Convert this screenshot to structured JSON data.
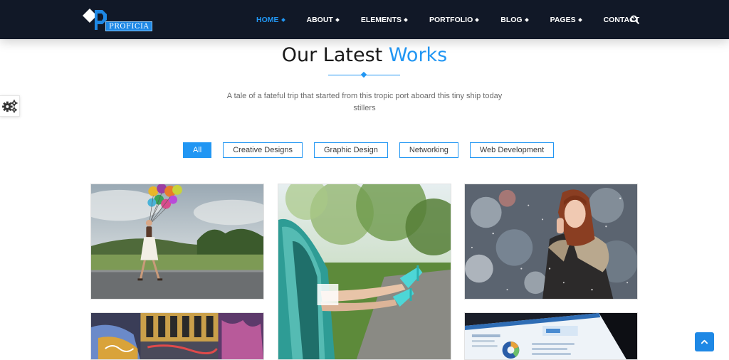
{
  "brand": {
    "logo_text": "PROFICIA"
  },
  "nav": {
    "items": [
      {
        "label": "HOME",
        "active": true,
        "dropdown": true
      },
      {
        "label": "ABOUT",
        "active": false,
        "dropdown": true
      },
      {
        "label": "ELEMENTS",
        "active": false,
        "dropdown": true
      },
      {
        "label": "PORTFOLIO",
        "active": false,
        "dropdown": true
      },
      {
        "label": "BLOG",
        "active": false,
        "dropdown": true
      },
      {
        "label": "PAGES",
        "active": false,
        "dropdown": true
      },
      {
        "label": "CONTACT",
        "active": false,
        "dropdown": false
      }
    ],
    "search_icon": "search-icon"
  },
  "section": {
    "title_main": "Our Latest ",
    "title_accent": "Works",
    "subtitle": "A tale of a fateful trip that started from this tropic port aboard this tiny ship today stillers"
  },
  "filters": [
    {
      "label": "All",
      "active": true
    },
    {
      "label": "Creative Designs",
      "active": false
    },
    {
      "label": "Graphic Design",
      "active": false
    },
    {
      "label": "Networking",
      "active": false
    },
    {
      "label": "Web Development",
      "active": false
    }
  ],
  "gallery": [
    {
      "subject": "woman-with-balloons-on-road"
    },
    {
      "subject": "legs-out-of-car-window"
    },
    {
      "subject": "woman-in-fur-coat-snow"
    },
    {
      "subject": "graffiti-building"
    },
    {
      "subject": "analytics-dashboard-screen"
    }
  ],
  "icons": {
    "settings": "gears-icon",
    "back_to_top": "chevron-up-icon"
  },
  "colors": {
    "accent": "#2196f3",
    "navbar": "#111827",
    "title": "#1a1a1a",
    "body_text": "#6b6b6b"
  }
}
